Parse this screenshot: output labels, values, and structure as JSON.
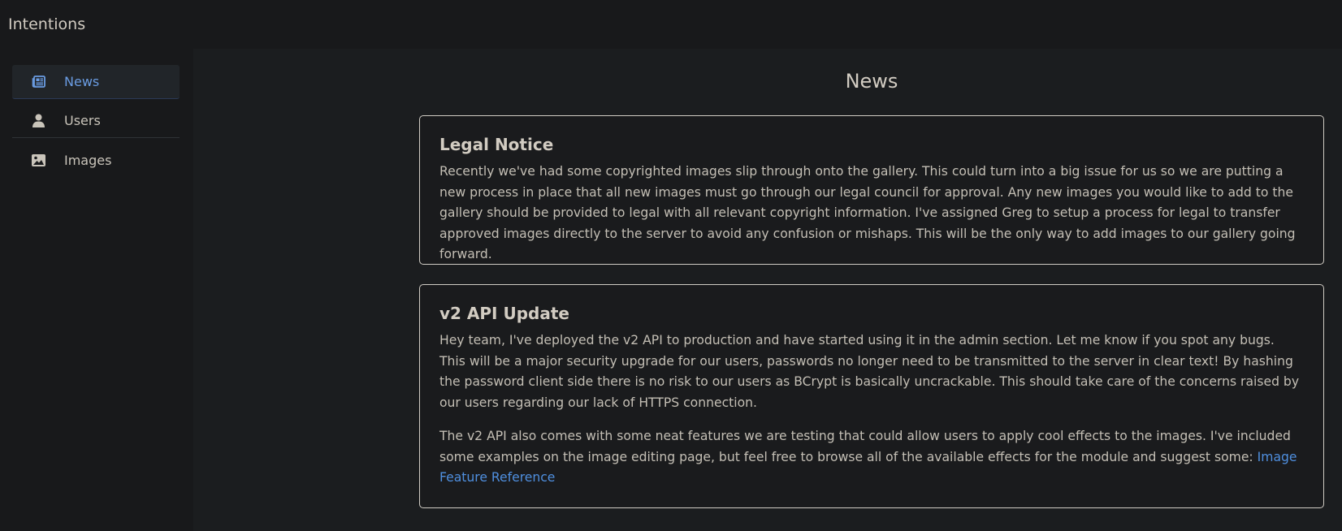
{
  "app": {
    "title": "Intentions"
  },
  "sidebar": {
    "items": [
      {
        "label": "News",
        "icon": "newspaper-icon",
        "active": true
      },
      {
        "label": "Users",
        "icon": "user-icon",
        "active": false
      },
      {
        "label": "Images",
        "icon": "image-icon",
        "active": false
      }
    ]
  },
  "main": {
    "title": "News",
    "cards": [
      {
        "title": "Legal Notice",
        "paragraphs": [
          "Recently we've had some copyrighted images slip through onto the gallery. This could turn into a big issue for us so we are putting a new process in place that all new images must go through our legal council for approval. Any new images you would like to add to the gallery should be provided to legal with all relevant copyright information. I've assigned Greg to setup a process for legal to transfer approved images directly to the server to avoid any confusion or mishaps. This will be the only way to add images to our gallery going forward."
        ]
      },
      {
        "title": "v2 API Update",
        "paragraphs": [
          "Hey team, I've deployed the v2 API to production and have started using it in the admin section. Let me know if you spot any bugs. This will be a major security upgrade for our users, passwords no longer need to be transmitted to the server in clear text! By hashing the password client side there is no risk to our users as BCrypt is basically uncrackable. This should take care of the concerns raised by our users regarding our lack of HTTPS connection.",
          "The v2 API also comes with some neat features we are testing that could allow users to apply cool effects to the images. I've included some examples on the image editing page, but feel free to browse all of the available effects for the module and suggest some: "
        ],
        "link_label": "Image Feature Reference"
      }
    ]
  },
  "colors": {
    "accent": "#6a9ce2",
    "link": "#4f8fdf",
    "background": "#18191b",
    "card_border": "#d0ccc4"
  }
}
